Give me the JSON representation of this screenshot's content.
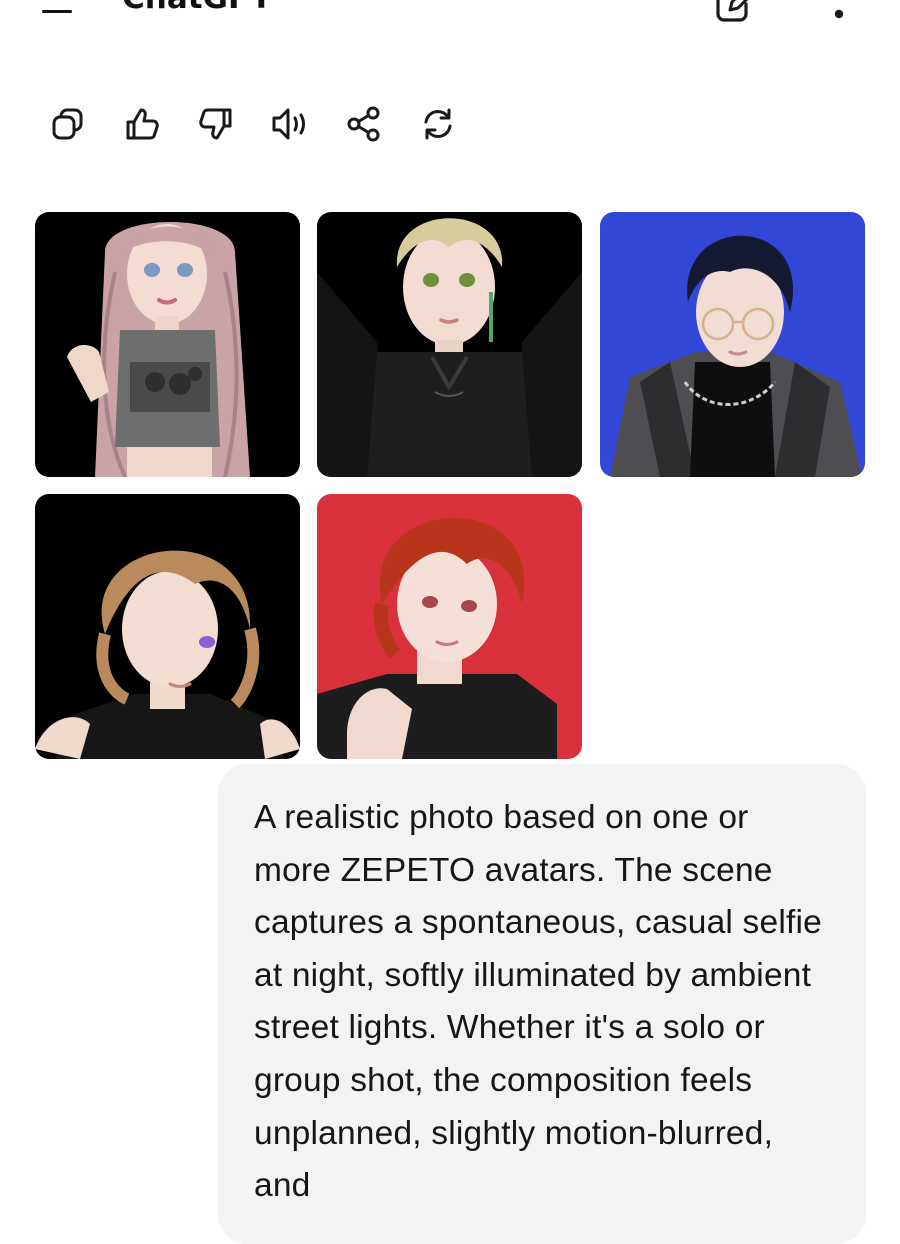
{
  "header": {
    "title": "ChatGPT"
  },
  "actions": [
    {
      "name": "copy",
      "icon": "copy-icon"
    },
    {
      "name": "like",
      "icon": "thumbs-up-icon"
    },
    {
      "name": "dislike",
      "icon": "thumbs-down-icon"
    },
    {
      "name": "read-aloud",
      "icon": "speaker-icon"
    },
    {
      "name": "share",
      "icon": "share-icon"
    },
    {
      "name": "regenerate",
      "icon": "regenerate-icon"
    }
  ],
  "images": [
    {
      "name": "avatar-pink-hair",
      "background": "#000000"
    },
    {
      "name": "avatar-blonde-hair",
      "background": "#000000"
    },
    {
      "name": "avatar-glasses-navy-hair",
      "background": "#3347d6"
    },
    {
      "name": "avatar-brown-hair",
      "background": "#000000"
    },
    {
      "name": "avatar-red-hair",
      "background": "#d8313b"
    }
  ],
  "message": {
    "text": "A realistic photo based on one or more ZEPETO avatars. The scene captures a spontaneous, casual selfie at night, softly illuminated by ambient street lights. Whether it's a solo or group shot, the composition feels unplanned, slightly motion-blurred, and"
  },
  "colors": {
    "bubble": "#f3f3f3",
    "icon": "#1a1a1a"
  }
}
